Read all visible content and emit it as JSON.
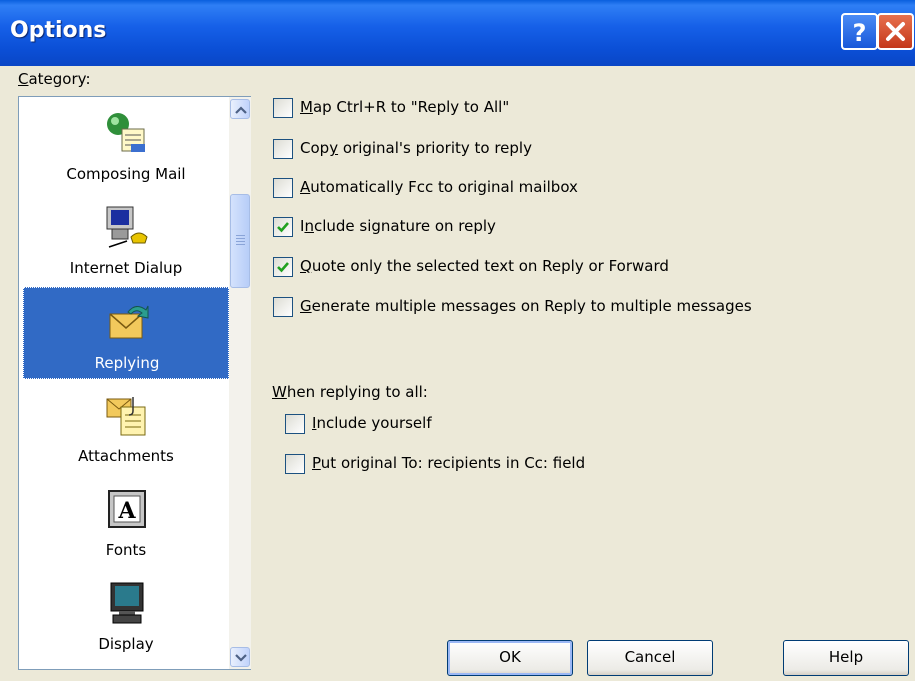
{
  "window": {
    "title": "Options",
    "help_glyph": "?",
    "close_glyph": "X"
  },
  "category": {
    "label_key": "C",
    "label_rest": "ategory:",
    "items": [
      {
        "label": "Composing Mail",
        "icon": "composing-mail-icon",
        "selected": false
      },
      {
        "label": "Internet Dialup",
        "icon": "internet-dialup-icon",
        "selected": false
      },
      {
        "label": "Replying",
        "icon": "replying-icon",
        "selected": true
      },
      {
        "label": "Attachments",
        "icon": "attachments-icon",
        "selected": false
      },
      {
        "label": "Fonts",
        "icon": "fonts-icon",
        "selected": false
      },
      {
        "label": "Display",
        "icon": "display-icon",
        "selected": false
      }
    ]
  },
  "options": [
    {
      "pre": "",
      "key": "M",
      "post": "ap Ctrl+R to \"Reply to All\"",
      "checked": false
    },
    {
      "pre": "Cop",
      "key": "y",
      "post": " original's priority to reply",
      "checked": false
    },
    {
      "pre": "",
      "key": "A",
      "post": "utomatically Fcc to original mailbox",
      "checked": false
    },
    {
      "pre": "I",
      "key": "n",
      "post": "clude signature on reply",
      "checked": true
    },
    {
      "pre": "",
      "key": "Q",
      "post": "uote only the selected text on Reply or Forward",
      "checked": true
    },
    {
      "pre": "",
      "key": "G",
      "post": "enerate multiple messages on Reply to multiple messages",
      "checked": false
    }
  ],
  "reply_all": {
    "label_key": "W",
    "label_rest": "hen replying to all:",
    "options": [
      {
        "pre": "",
        "key": "I",
        "post": "nclude yourself",
        "checked": false
      },
      {
        "pre": "",
        "key": "P",
        "post": "ut original To: recipients in Cc: field",
        "checked": false
      }
    ]
  },
  "buttons": {
    "ok": "OK",
    "cancel": "Cancel",
    "help": "Help"
  },
  "colors": {
    "titlebar": "#0a4fd6",
    "selection": "#316ac5",
    "dialog_bg": "#ece9d8",
    "checkmark": "#21a121"
  }
}
